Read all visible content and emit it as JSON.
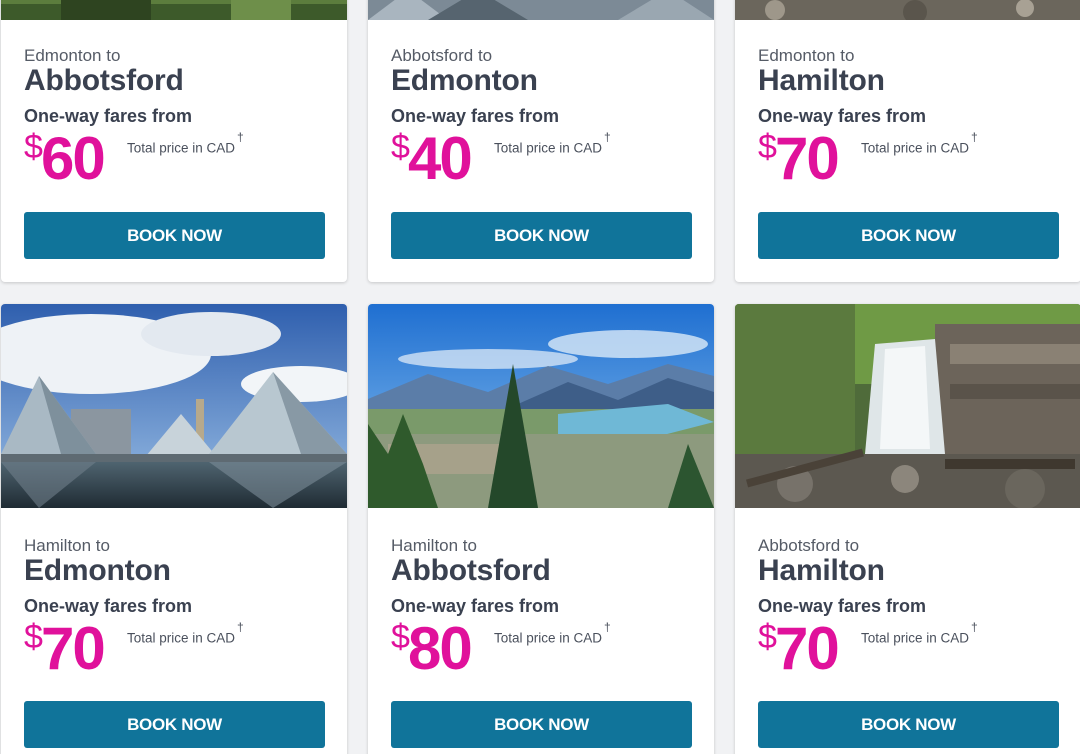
{
  "cards": [
    {
      "from": "Edmonton to",
      "to": "Abbotsford",
      "fares_label": "One-way fares from",
      "currency": "$",
      "price": "60",
      "total_label": "Total price in CAD",
      "dagger": "†",
      "button": "BOOK NOW"
    },
    {
      "from": "Abbotsford to",
      "to": "Edmonton",
      "fares_label": "One-way fares from",
      "currency": "$",
      "price": "40",
      "total_label": "Total price in CAD",
      "dagger": "†",
      "button": "BOOK NOW"
    },
    {
      "from": "Edmonton to",
      "to": "Hamilton",
      "fares_label": "One-way fares from",
      "currency": "$",
      "price": "70",
      "total_label": "Total price in CAD",
      "dagger": "†",
      "button": "BOOK NOW"
    },
    {
      "from": "Hamilton to",
      "to": "Edmonton",
      "fares_label": "One-way fares from",
      "currency": "$",
      "price": "70",
      "total_label": "Total price in CAD",
      "dagger": "†",
      "button": "BOOK NOW"
    },
    {
      "from": "Hamilton to",
      "to": "Abbotsford",
      "fares_label": "One-way fares from",
      "currency": "$",
      "price": "80",
      "total_label": "Total price in CAD",
      "dagger": "†",
      "button": "BOOK NOW"
    },
    {
      "from": "Abbotsford to",
      "to": "Hamilton",
      "fares_label": "One-way fares from",
      "currency": "$",
      "price": "70",
      "total_label": "Total price in CAD",
      "dagger": "†",
      "button": "BOOK NOW"
    }
  ],
  "colors": {
    "price": "#e0119b",
    "button": "#10749a",
    "heading": "#3a4150"
  }
}
